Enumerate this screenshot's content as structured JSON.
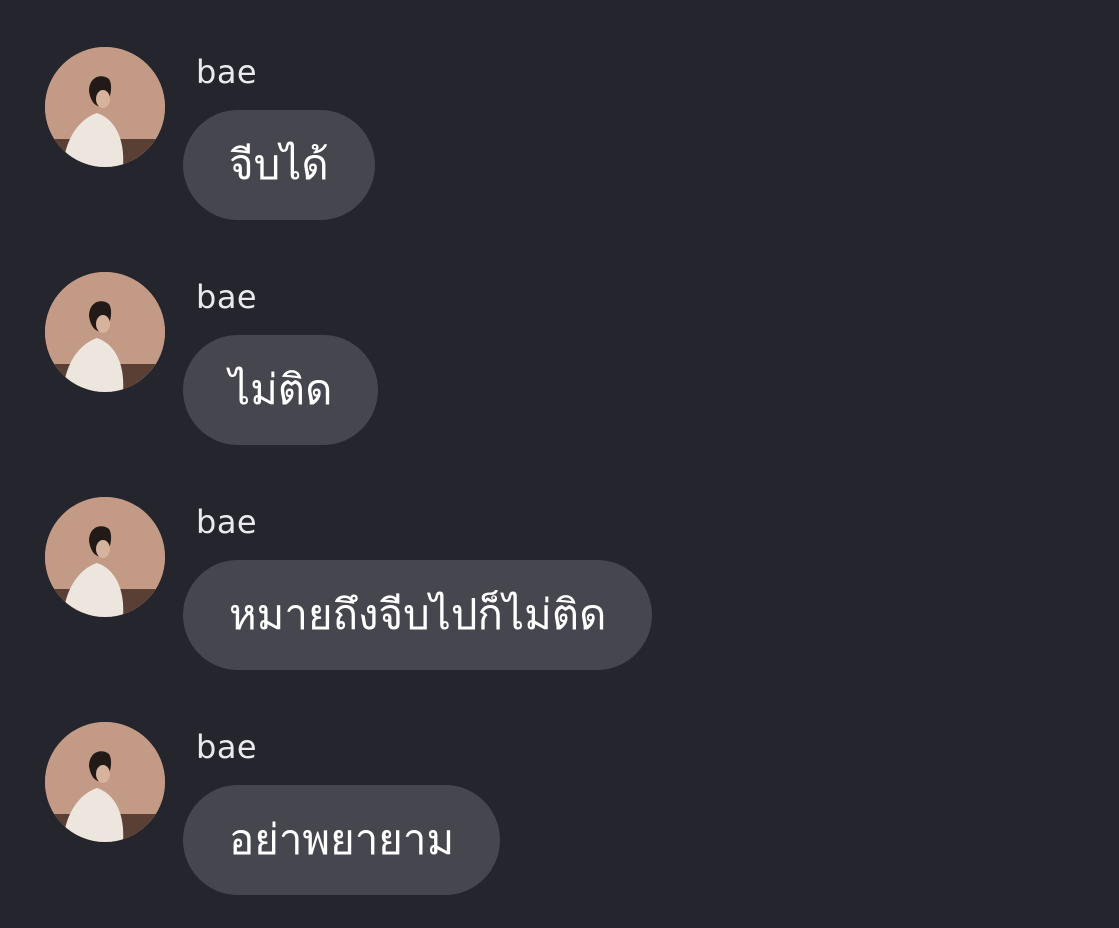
{
  "theme": {
    "background": "#25252d",
    "bubble": "#46464f",
    "sender_color": "#e9e9ee",
    "text_color": "#ffffff"
  },
  "messages": [
    {
      "sender": "bae",
      "text": "จีบได้",
      "avatar": "profile-photo"
    },
    {
      "sender": "bae",
      "text": "ไม่ติด",
      "avatar": "profile-photo"
    },
    {
      "sender": "bae",
      "text": "หมายถึงจีบไปก็ไม่ติด",
      "avatar": "profile-photo"
    },
    {
      "sender": "bae",
      "text": "อย่าพยายาม",
      "avatar": "profile-photo"
    }
  ]
}
